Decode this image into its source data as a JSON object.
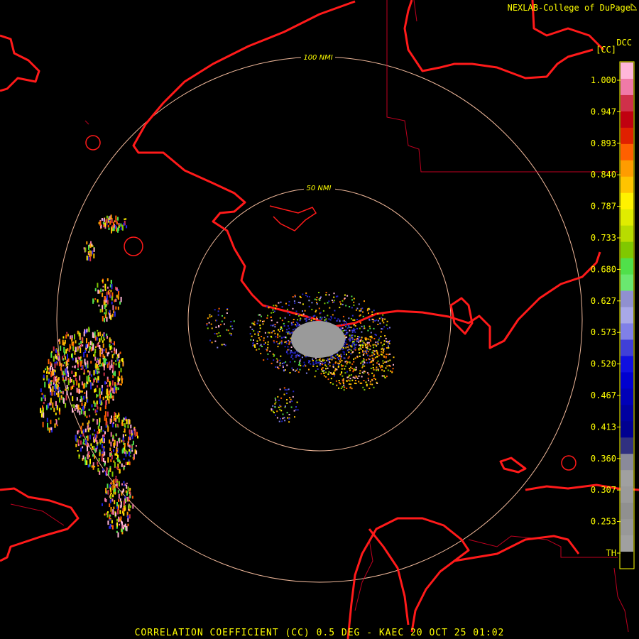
{
  "header": {
    "credit": "NEXLAB-College of DuPage",
    "credit_icon": "cursor-arrow-icon"
  },
  "legend": {
    "unit_top": "DCC",
    "unit": "[CC]",
    "labels": [
      "1.000",
      "0.947",
      "0.893",
      "0.840",
      "0.787",
      "0.733",
      "0.680",
      "0.627",
      "0.573",
      "0.520",
      "0.467",
      "0.413",
      "0.360",
      "0.307",
      "0.253",
      "TH"
    ],
    "colors": [
      "#ffb6d9",
      "#f07aa8",
      "#d0304a",
      "#c00010",
      "#e02000",
      "#ff6000",
      "#ff9c00",
      "#ffc400",
      "#fff200",
      "#e0ec00",
      "#b8dc00",
      "#80c800",
      "#50e04a",
      "#6ae870",
      "#9090d0",
      "#a8a8e8",
      "#8080e8",
      "#4040d8",
      "#1010e0",
      "#0000d0",
      "#0000b8",
      "#0000a0",
      "#000090",
      "#303080",
      "#8a8a9a",
      "#a0a0a0",
      "#9a9a9a",
      "#909090",
      "#989898",
      "#a0a0a0",
      "#000000"
    ]
  },
  "rings": {
    "inner_label": "50 NMI",
    "outer_label": "100 NMI"
  },
  "footer": {
    "caption": "CORRELATION COEFFICIENT (CC) 0.5 DEG - KAEC 20 OCT 25 01:02"
  },
  "colors": {
    "coastline": "#ff1a1a",
    "range_ring": "#f0b89a",
    "county_line": "#c00020",
    "text": "#ffff00"
  }
}
